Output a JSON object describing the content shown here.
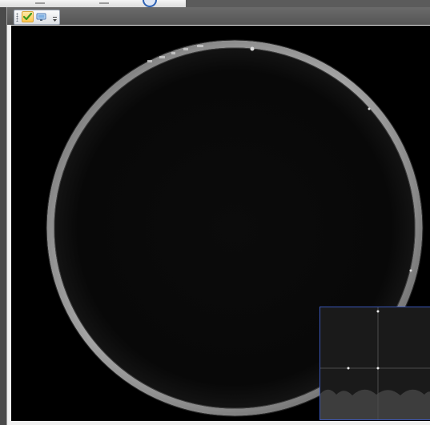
{
  "window": {
    "toolbar": {
      "buttons": [
        {
          "name": "accept",
          "icon": "checkmark-icon",
          "state": "active"
        },
        {
          "name": "monitor",
          "icon": "monitor-icon",
          "state": "normal"
        }
      ],
      "overflow_icon": "chevron-down-icon"
    }
  },
  "colors": {
    "accent_active": "#ffc84e",
    "minimap_border": "#3b57b8",
    "ring": "#9a9a9a",
    "background": "#000000"
  }
}
